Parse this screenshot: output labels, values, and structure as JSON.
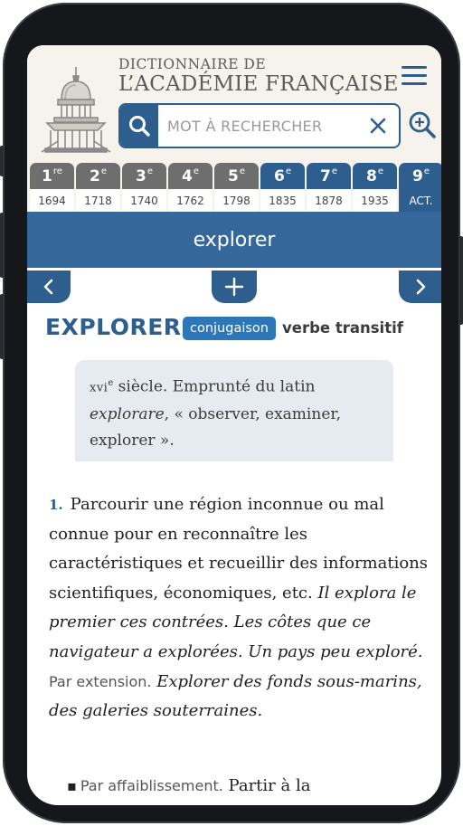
{
  "header": {
    "brand_line1": "DICTIONNAIRE DE",
    "brand_line2": "L’ACADÉMIE FRANÇAISE"
  },
  "search": {
    "placeholder": "MOT À RECHERCHER",
    "value": ""
  },
  "editions": [
    {
      "num": "1",
      "sup": "re",
      "year": "1694"
    },
    {
      "num": "2",
      "sup": "e",
      "year": "1718"
    },
    {
      "num": "3",
      "sup": "e",
      "year": "1740"
    },
    {
      "num": "4",
      "sup": "e",
      "year": "1762"
    },
    {
      "num": "5",
      "sup": "e",
      "year": "1798"
    },
    {
      "num": "6",
      "sup": "e",
      "year": "1835"
    },
    {
      "num": "7",
      "sup": "e",
      "year": "1878"
    },
    {
      "num": "8",
      "sup": "e",
      "year": "1935"
    },
    {
      "num": "9",
      "sup": "e",
      "year": "ACT."
    }
  ],
  "band": {
    "word": "explorer"
  },
  "entry": {
    "headword": "EXPLORER",
    "conjugation_button": "conjugaison",
    "category": "verbe transitif",
    "etymology": {
      "century": "xvi",
      "century_sup": "e",
      "text1": " siècle. Emprunté du latin",
      "latin": "explorare",
      "text2": ", « observer, examiner, explorer »."
    },
    "definition": {
      "number": "1.",
      "text": "Parcourir une région inconnue ou mal connue pour en reconnaître les caractéristiques et recueillir des informations scientifiques, économiques, etc.",
      "example1": "Il explora le premier ces contrées. Les côtes que ce navigateur a explorées. Un pays peu exploré.",
      "label": "Par extension.",
      "example2": "Explorer des fonds sous-marins, des galeries souterraines."
    },
    "subsense": {
      "bullet": "▪",
      "label": "Par affaiblissement.",
      "text": "Partir à la"
    }
  },
  "colors": {
    "primary": "#2d5e8e",
    "band": "#35679a",
    "tab_grey": "#6e6e6e",
    "header_bg": "#f6f3ec",
    "etym_bg": "#e6ebf1",
    "conj_bg": "#2d77b8"
  },
  "icons": {
    "search": "search-icon",
    "clear": "close-icon",
    "menu": "hamburger-menu-icon",
    "zoom": "zoom-in-icon",
    "prev": "chevron-left-icon",
    "next": "chevron-right-icon",
    "expand": "plus-icon",
    "logo": "academie-dome-logo"
  }
}
